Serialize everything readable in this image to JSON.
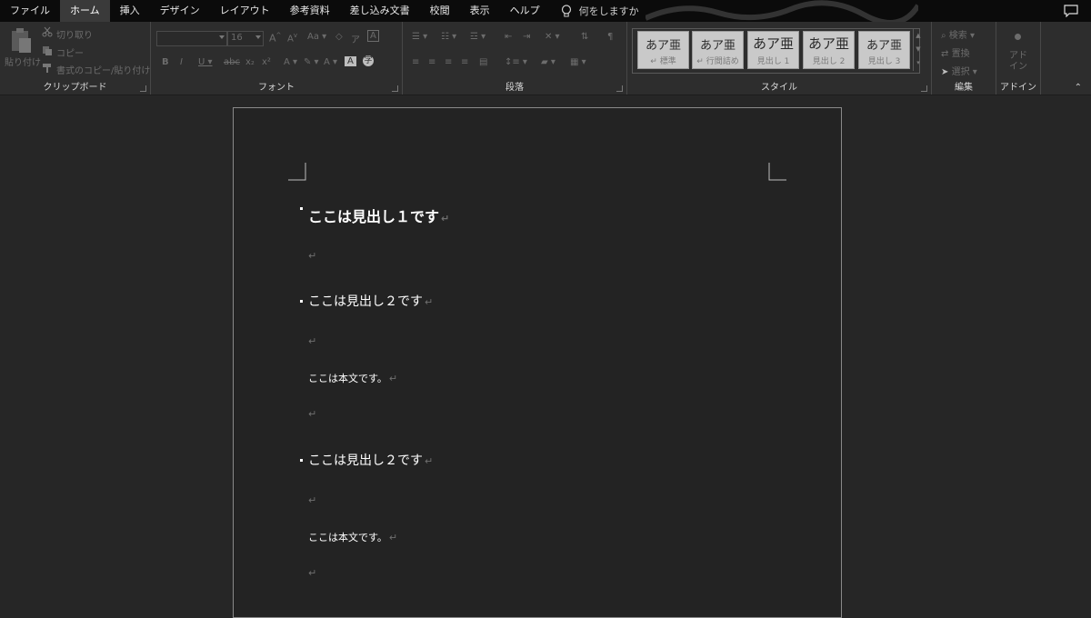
{
  "tabs": [
    {
      "label": "ファイル",
      "active": false
    },
    {
      "label": "ホーム",
      "active": true
    },
    {
      "label": "挿入",
      "active": false
    },
    {
      "label": "デザイン",
      "active": false
    },
    {
      "label": "レイアウト",
      "active": false
    },
    {
      "label": "参考資料",
      "active": false
    },
    {
      "label": "差し込み文書",
      "active": false
    },
    {
      "label": "校閲",
      "active": false
    },
    {
      "label": "表示",
      "active": false
    },
    {
      "label": "ヘルプ",
      "active": false
    }
  ],
  "tell_me": "何をしますか",
  "ribbon": {
    "clipboard": {
      "label": "クリップボード",
      "paste": "貼り付け",
      "cut": "切り取り",
      "copy": "コピー",
      "format_painter": "書式のコピー/貼り付け"
    },
    "font": {
      "label": "フォント",
      "font_name": "",
      "font_size": "16"
    },
    "paragraph": {
      "label": "段落"
    },
    "styles": {
      "label": "スタイル",
      "items": [
        {
          "sample": "あア亜",
          "name": "↵ 標準"
        },
        {
          "sample": "あア亜",
          "name": "↵ 行間詰め"
        },
        {
          "sample": "あア亜",
          "name": "見出し 1"
        },
        {
          "sample": "あア亜",
          "name": "見出し 2"
        },
        {
          "sample": "あア亜",
          "name": "見出し 3"
        }
      ]
    },
    "editing": {
      "label": "編集",
      "find": "検索",
      "replace": "置換",
      "select": "選択"
    },
    "addins": {
      "label": "アドイン",
      "button": "アド\nイン"
    }
  },
  "document": {
    "paragraphs": [
      {
        "style": "h1",
        "text": "ここは見出し１です",
        "bullet": true
      },
      {
        "style": "empty",
        "text": ""
      },
      {
        "style": "h2",
        "text": "ここは見出し２です",
        "bullet": true
      },
      {
        "style": "empty",
        "text": ""
      },
      {
        "style": "body",
        "text": "ここは本文です。",
        "bullet": false
      },
      {
        "style": "empty",
        "text": ""
      },
      {
        "style": "h2",
        "text": "ここは見出し２です",
        "bullet": true
      },
      {
        "style": "empty",
        "text": ""
      },
      {
        "style": "body",
        "text": "ここは本文です。",
        "bullet": false
      },
      {
        "style": "empty",
        "text": ""
      }
    ],
    "para_mark": "↵"
  }
}
